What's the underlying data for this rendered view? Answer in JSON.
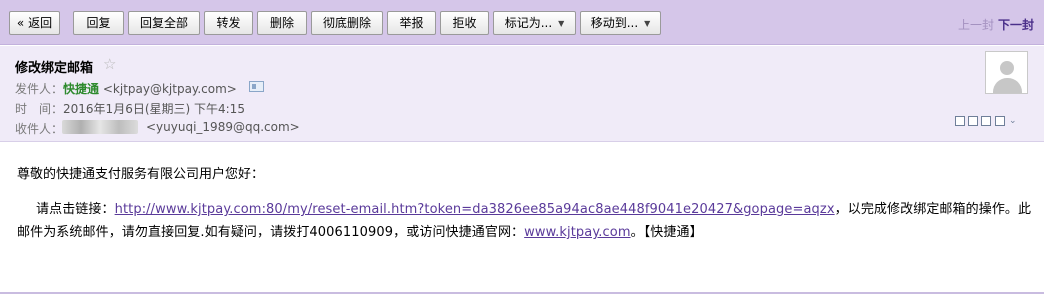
{
  "toolbar": {
    "back": "« 返回",
    "reply": "回复",
    "reply_all": "回复全部",
    "forward": "转发",
    "delete": "删除",
    "delete_forever": "彻底删除",
    "report": "举报",
    "reject": "拒收",
    "mark_as": "标记为...",
    "move_to": "移动到...",
    "prev": "上一封",
    "next": "下一封"
  },
  "header": {
    "subject": "修改绑定邮箱",
    "star": "☆",
    "from_label": "发件人：",
    "from_name": "快捷通",
    "from_email": "<kjtpay@kjtpay.com>",
    "time_label": "时　间：",
    "time_value": "2016年1月6日(星期三) 下午4:15",
    "to_label": "收件人：",
    "to_email": "<yuyuqi_1989@qq.com>"
  },
  "body": {
    "greeting": "尊敬的快捷通支付服务有限公司用户您好：",
    "para_pre": "请点击链接：",
    "reset_link": "http://www.kjtpay.com:80/my/reset-email.htm?token=da3826ee85a94ac8ae448f9041e20427&gopage=aqzx",
    "para_mid": "，以完成修改绑定邮箱的操作。此邮件为系统邮件，请勿直接回复.如有疑问，请拨打4006110909，或访问快捷通官网：",
    "site_link": "www.kjtpay.com",
    "para_post": "。【快捷通】"
  }
}
